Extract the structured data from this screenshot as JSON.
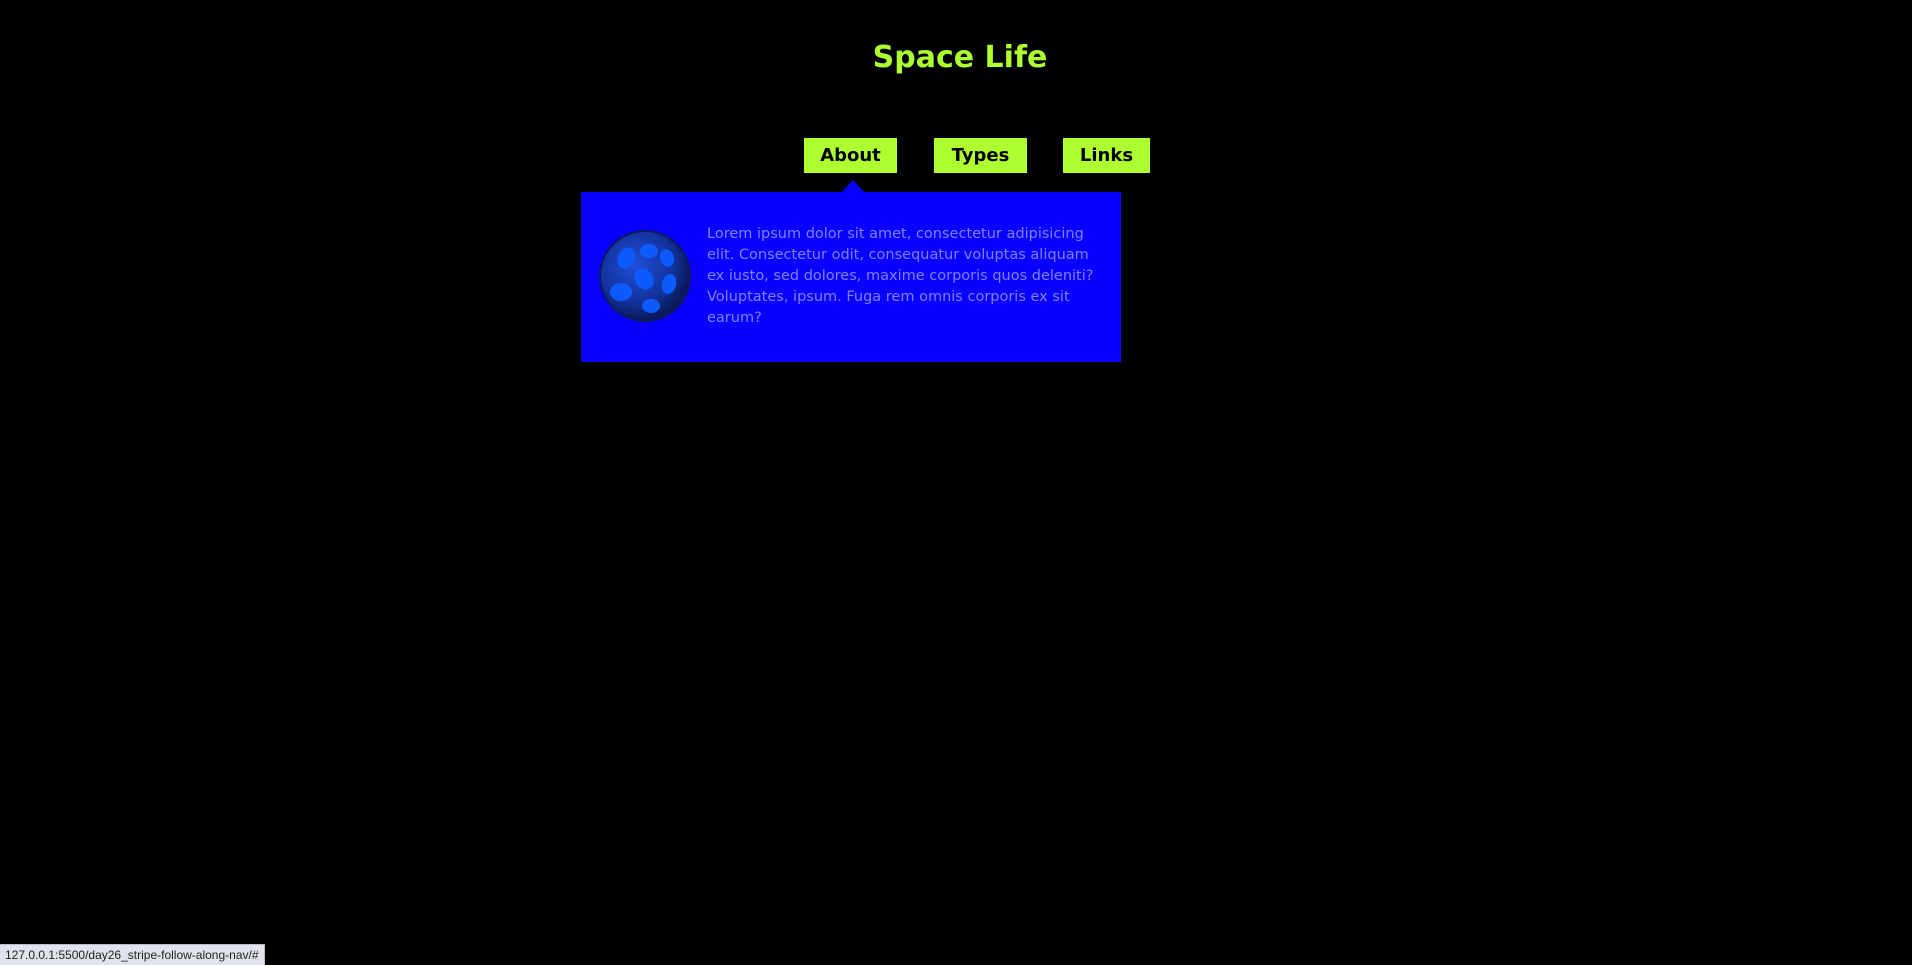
{
  "header": {
    "title": "Space Life"
  },
  "nav": {
    "items": [
      {
        "label": "About"
      },
      {
        "label": "Types"
      },
      {
        "label": "Links"
      }
    ]
  },
  "dropdown": {
    "active_item": "About",
    "icon": "planet-icon",
    "text": "Lorem ipsum dolor sit amet, consectetur adipisicing elit. Consectetur odit, consequatur voluptas aliquam ex iusto, sed dolores, maxime corporis quos deleniti? Voluptates, ipsum. Fuga rem omnis corporis ex sit earum?"
  },
  "status_bar": {
    "url": "127.0.0.1:5500/day26_stripe-follow-along-nav/#"
  },
  "colors": {
    "background": "#000000",
    "accent": "#adff2f",
    "dropdown_background": "#0a00ff",
    "dropdown_text": "#7f82ff"
  }
}
